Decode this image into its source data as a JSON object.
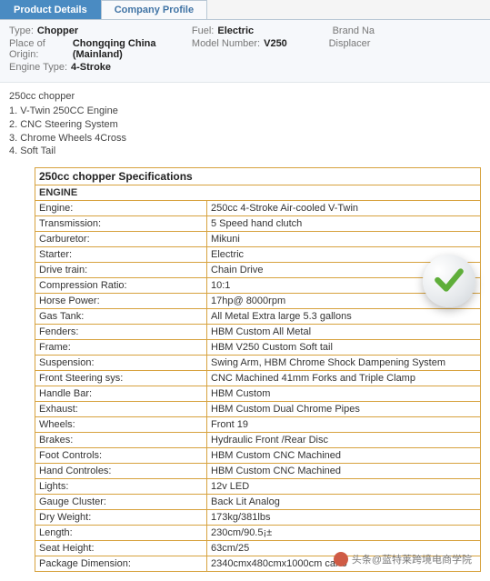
{
  "tabs": {
    "active": "Product Details",
    "inactive": "Company Profile"
  },
  "details": {
    "row1": [
      {
        "label": "Type:",
        "value": "Chopper"
      },
      {
        "label": "Fuel:",
        "value": "Electric"
      },
      {
        "label": "",
        "value": "Brand Na"
      }
    ],
    "row2": [
      {
        "label": "Place of Origin:",
        "value": "Chongqing China (Mainland)"
      },
      {
        "label": "Model Number:",
        "value": "V250"
      },
      {
        "label": "",
        "value": "Displacer"
      }
    ],
    "row3": [
      {
        "label": "Engine Type:",
        "value": "4-Stroke"
      },
      {
        "label": "",
        "value": ""
      },
      {
        "label": "",
        "value": ""
      }
    ]
  },
  "desc": {
    "title": "250cc chopper",
    "items": [
      "1. V-Twin 250CC Engine",
      "2. CNC Steering System",
      "3. Chrome Wheels 4Cross",
      "4. Soft Tail"
    ]
  },
  "spec_title": "250cc chopper Specifications",
  "spec_section": "ENGINE",
  "specs": [
    {
      "k": "Engine:",
      "v": "250cc 4-Stroke Air-cooled V-Twin"
    },
    {
      "k": "Transmission:",
      "v": "5 Speed hand clutch"
    },
    {
      "k": "Carburetor:",
      "v": "Mikuni"
    },
    {
      "k": "Starter:",
      "v": "Electric"
    },
    {
      "k": "Drive train:",
      "v": "Chain Drive"
    },
    {
      "k": "Compression Ratio:",
      "v": "10:1"
    },
    {
      "k": "Horse Power:",
      "v": "17hp@ 8000rpm"
    },
    {
      "k": "Gas Tank:",
      "v": "All Metal Extra large 5.3 gallons"
    },
    {
      "k": "Fenders:",
      "v": "HBM Custom All Metal"
    },
    {
      "k": "Frame:",
      "v": "HBM V250 Custom Soft tail"
    },
    {
      "k": "Suspension:",
      "v": "Swing Arm, HBM Chrome Shock Dampening System"
    },
    {
      "k": "Front Steering sys:",
      "v": "CNC Machined 41mm Forks and Triple Clamp"
    },
    {
      "k": "Handle Bar:",
      "v": "HBM Custom"
    },
    {
      "k": "Exhaust:",
      "v": "HBM Custom Dual Chrome Pipes"
    },
    {
      "k": "Wheels:",
      "v": "Front 19"
    },
    {
      "k": "Brakes:",
      "v": "Hydraulic Front /Rear Disc"
    },
    {
      "k": "Foot Controls:",
      "v": "HBM Custom CNC Machined"
    },
    {
      "k": "Hand Controles:",
      "v": "HBM Custom CNC Machined"
    },
    {
      "k": "Lights:",
      "v": "12v LED"
    },
    {
      "k": "Gauge Cluster:",
      "v": "Back Lit Analog"
    },
    {
      "k": "Dry Weight:",
      "v": "173kg/381lbs"
    },
    {
      "k": "Length:",
      "v": "230cm/90.5¡±"
    },
    {
      "k": "Seat Height:",
      "v": "63cm/25"
    },
    {
      "k": "Package Dimension:",
      "v": "2340cmx480cmx1000cm carto"
    }
  ],
  "watermark": "头条@蓝特莱跨境电商学院"
}
